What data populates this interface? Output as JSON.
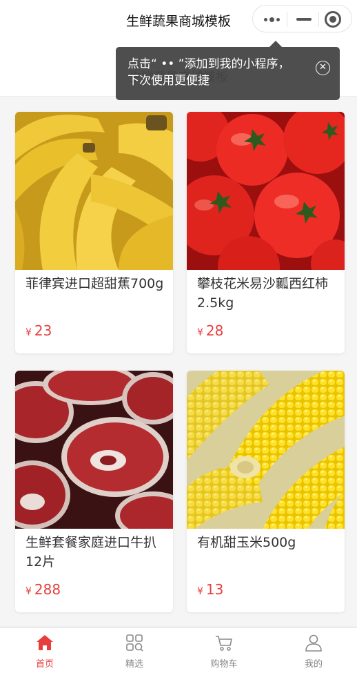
{
  "nav": {
    "title": "生鲜蔬果商城模板"
  },
  "page": {
    "heading": "生鲜蔬果商城模板"
  },
  "capsule": {
    "more_icon": "more-dots-icon",
    "minimize_icon": "minimize-icon",
    "close_icon": "target-circle-icon"
  },
  "tip": {
    "text_line1": "点击“ •• ”添加到我的小程序，",
    "text_line2": "下次使用更便捷",
    "close_glyph": "✕"
  },
  "currency": "¥",
  "products": [
    {
      "name": "菲律宾进口超甜蕉700g",
      "price": "23"
    },
    {
      "name": "攀枝花米易沙瓤西红柿2.5kg",
      "price": "28"
    },
    {
      "name": "生鲜套餐家庭进口牛扒12片",
      "price": "288"
    },
    {
      "name": "有机甜玉米500g",
      "price": "13"
    }
  ],
  "tabbar": [
    {
      "label": "首页",
      "icon": "home-icon",
      "active": true
    },
    {
      "label": "精选",
      "icon": "grid-icon",
      "active": false
    },
    {
      "label": "购物车",
      "icon": "cart-icon",
      "active": false
    },
    {
      "label": "我的",
      "icon": "user-icon",
      "active": false
    }
  ],
  "colors": {
    "accent": "#e83d3d",
    "tip_bg": "#444444",
    "page_bg": "#f5f5f5"
  }
}
